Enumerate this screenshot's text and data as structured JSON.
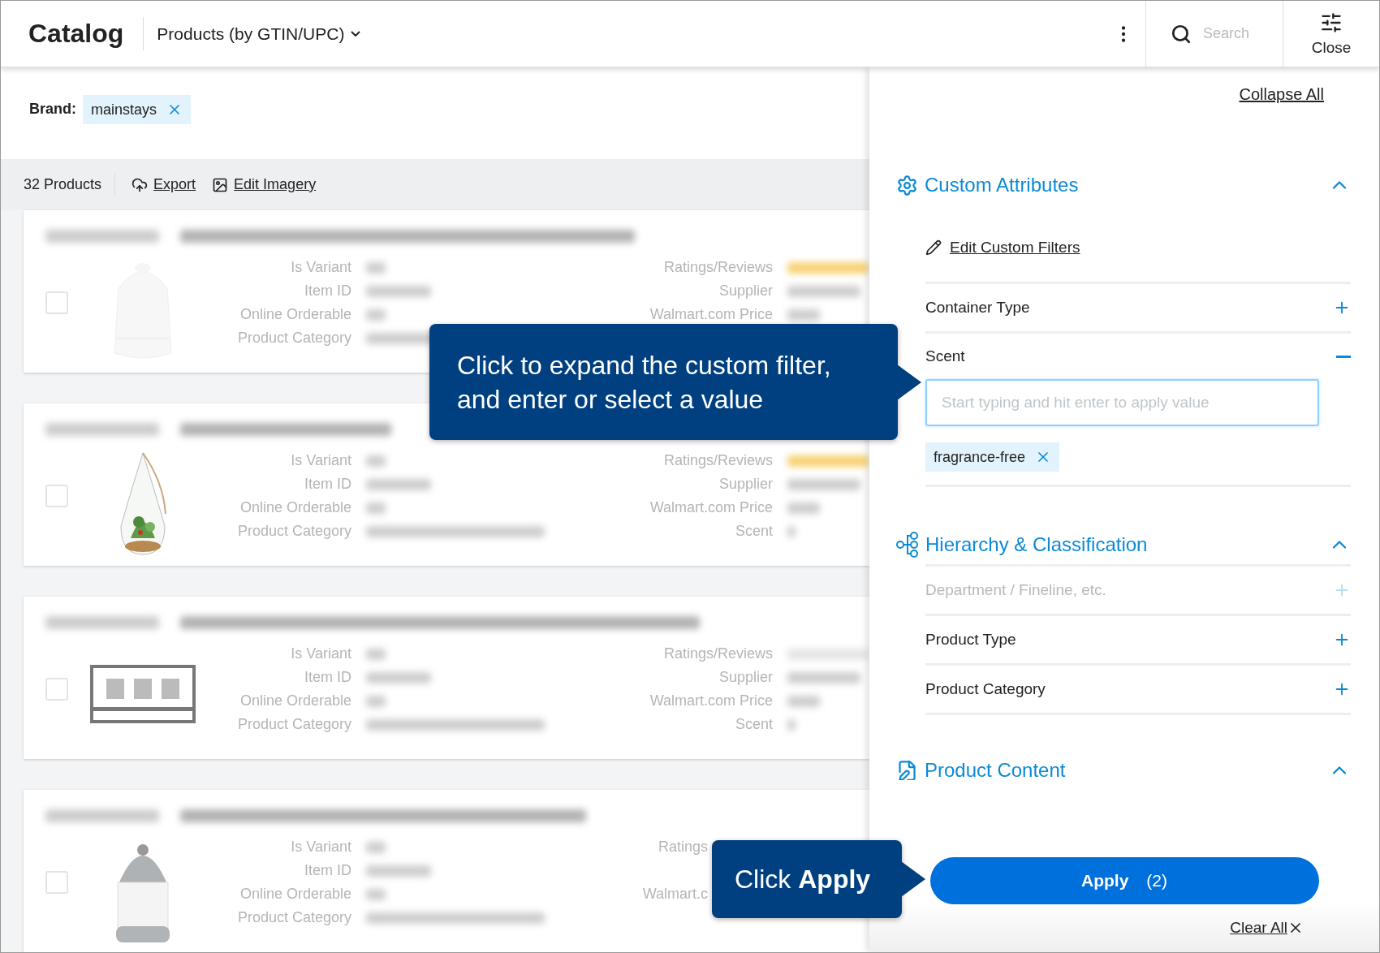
{
  "header": {
    "title": "Catalog",
    "view_selector": "Products (by GTIN/UPC)",
    "search": {
      "placeholder": "Search"
    },
    "close_label": "Close"
  },
  "brand_filter": {
    "label": "Brand:",
    "chips": [
      {
        "text": "mainstays"
      }
    ]
  },
  "toolbar": {
    "count": "32 Products",
    "actions": [
      {
        "kind": "export",
        "label": "Export"
      },
      {
        "kind": "imagery",
        "label": "Edit Imagery"
      }
    ]
  },
  "products": [
    {
      "checked": false,
      "left_fields": [
        "Is Variant",
        "Item ID",
        "Online Orderable",
        "Product Category"
      ],
      "right_fields": [
        {
          "kind": "label",
          "label": "Ratings/Reviews"
        },
        {
          "kind": "label",
          "label": "Supplier"
        },
        {
          "kind": "label",
          "label": "Walmart.com Price"
        }
      ]
    },
    {
      "checked": false,
      "left_fields": [
        "Is Variant",
        "Item ID",
        "Online Orderable",
        "Product Category"
      ],
      "right_fields": [
        {
          "kind": "label",
          "label": "Ratings/Reviews"
        },
        {
          "kind": "label",
          "label": "Supplier"
        },
        {
          "kind": "label",
          "label": "Walmart.com Price"
        },
        {
          "kind": "label",
          "label": "Scent"
        }
      ]
    },
    {
      "checked": false,
      "left_fields": [
        "Is Variant",
        "Item ID",
        "Online Orderable",
        "Product Category"
      ],
      "right_fields": [
        {
          "kind": "label",
          "label": "Ratings/Reviews"
        },
        {
          "kind": "label",
          "label": "Supplier"
        },
        {
          "kind": "label",
          "label": "Walmart.com Price"
        },
        {
          "kind": "label",
          "label": "Scent"
        }
      ]
    },
    {
      "checked": false,
      "left_fields": [
        "Is Variant",
        "Item ID",
        "Online Orderable",
        "Product Category"
      ],
      "right_fields": [
        {
          "kind": "cut",
          "label": "Ratings"
        },
        {
          "kind": "covered"
        },
        {
          "kind": "cut",
          "label": "Walmart.c"
        }
      ]
    }
  ],
  "panel": {
    "collapse_all": "Collapse All",
    "sections": [
      {
        "kind": "custom",
        "title": "Custom Attributes",
        "expanded": true,
        "edit_link": "Edit Custom Filters",
        "filters": [
          {
            "label": "Container Type",
            "expanded": false,
            "disabled": false
          },
          {
            "label": "Scent",
            "expanded": true,
            "disabled": false,
            "input": {
              "placeholder": "Start typing and hit enter to apply value"
            },
            "chips": [
              {
                "text": "fragrance-free"
              }
            ]
          }
        ]
      },
      {
        "kind": "hierarchy",
        "title": "Hierarchy & Classification",
        "expanded": true,
        "filters": [
          {
            "label": "Department / Fineline, etc.",
            "expanded": false,
            "disabled": true
          },
          {
            "label": "Product Type",
            "expanded": false,
            "disabled": false
          },
          {
            "label": "Product Category",
            "expanded": false,
            "disabled": false
          }
        ]
      },
      {
        "kind": "content",
        "title": "Product Content",
        "expanded": true
      }
    ],
    "apply": {
      "label": "Apply",
      "count": "(2)"
    },
    "clear_all": "Clear All"
  },
  "callouts": [
    {
      "text": "Click to expand the custom filter, and enter or select a value"
    },
    {
      "text": "Click **Apply**"
    }
  ]
}
